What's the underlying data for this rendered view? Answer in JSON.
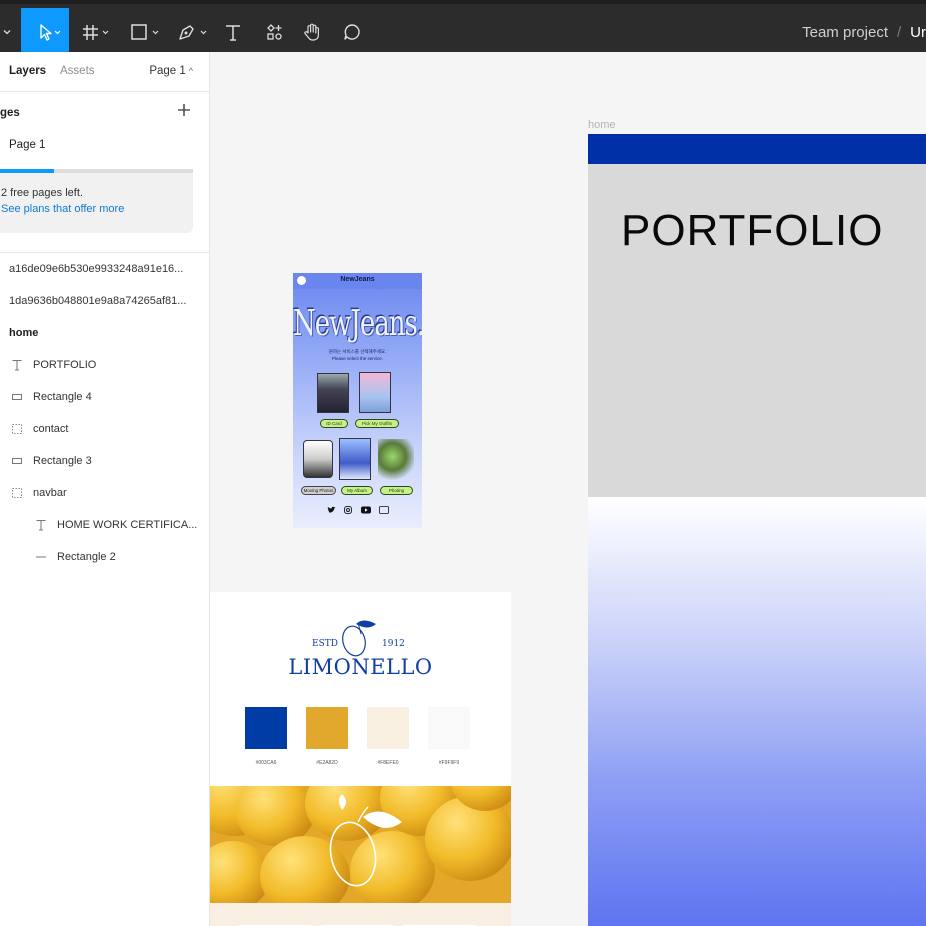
{
  "toolbar": {
    "tools": [
      {
        "name": "menu-chevron-icon"
      },
      {
        "name": "move-tool-icon",
        "active": true
      },
      {
        "name": "frame-tool-icon"
      },
      {
        "name": "shape-tool-icon"
      },
      {
        "name": "pen-tool-icon"
      },
      {
        "name": "text-tool-icon"
      },
      {
        "name": "resources-tool-icon"
      },
      {
        "name": "hand-tool-icon"
      },
      {
        "name": "comment-tool-icon"
      }
    ],
    "project": "Team project",
    "separator": "/",
    "file": "Ur"
  },
  "sidebar": {
    "tabs": {
      "layers": "Layers",
      "assets": "Assets"
    },
    "page_selector": "Page 1",
    "pages_header": "ges",
    "pages": [
      "Page 1"
    ],
    "upsell": {
      "message": "2 free pages left.",
      "link": "See plans that offer more",
      "progress": 0.28
    },
    "layers": [
      {
        "label": "a16de09e6b530e9933248a91e16...",
        "icon": "none",
        "indent": 0,
        "bold": false
      },
      {
        "label": "1da9636b048801e9a8a74265af81...",
        "icon": "none",
        "indent": 0,
        "bold": false
      },
      {
        "label": "home",
        "icon": "none",
        "indent": 0,
        "bold": true
      },
      {
        "label": "PORTFOLIO",
        "icon": "text-layer-icon",
        "indent": 1,
        "bold": false
      },
      {
        "label": "Rectangle 4",
        "icon": "rectangle-layer-icon",
        "indent": 1,
        "bold": false
      },
      {
        "label": "contact",
        "icon": "group-layer-icon",
        "indent": 1,
        "bold": false
      },
      {
        "label": "Rectangle 3",
        "icon": "rectangle-layer-icon",
        "indent": 1,
        "bold": false
      },
      {
        "label": "navbar",
        "icon": "group-layer-icon",
        "indent": 1,
        "bold": false
      },
      {
        "label": "HOME WORK CERTIFICA...",
        "icon": "text-layer-icon",
        "indent": 2,
        "bold": false
      },
      {
        "label": "Rectangle 2",
        "icon": "line-layer-icon",
        "indent": 2,
        "bold": false
      }
    ]
  },
  "canvas": {
    "frame_label": "home",
    "home": {
      "title": "PORTFOLIO",
      "nav_color": "#0030A8"
    },
    "phone": {
      "header": "NewJeans",
      "logo": "NewJeans.kr",
      "sub1": "원하는 서비스를 선택해주세요.",
      "sub2": "Please select the service.",
      "buttons": [
        "ID Card",
        "Pick My Outfits",
        "Moving Photos",
        "My Album",
        "Photing"
      ]
    },
    "limonello": {
      "estd": "ESTD",
      "year": "1912",
      "brand": "LIMONELLO",
      "swatches": [
        {
          "hex": "#003CA6",
          "label": "#003CA6"
        },
        {
          "hex": "#E2A82D",
          "label": "#E2A82D"
        },
        {
          "hex": "#F8EFE0",
          "label": "#F8EFE0"
        },
        {
          "hex": "#F9F9F9",
          "label": "#F9F9F9"
        }
      ]
    }
  },
  "colors": {
    "accent": "#0D99FF",
    "toolbar_bg": "#2C2C2C"
  }
}
